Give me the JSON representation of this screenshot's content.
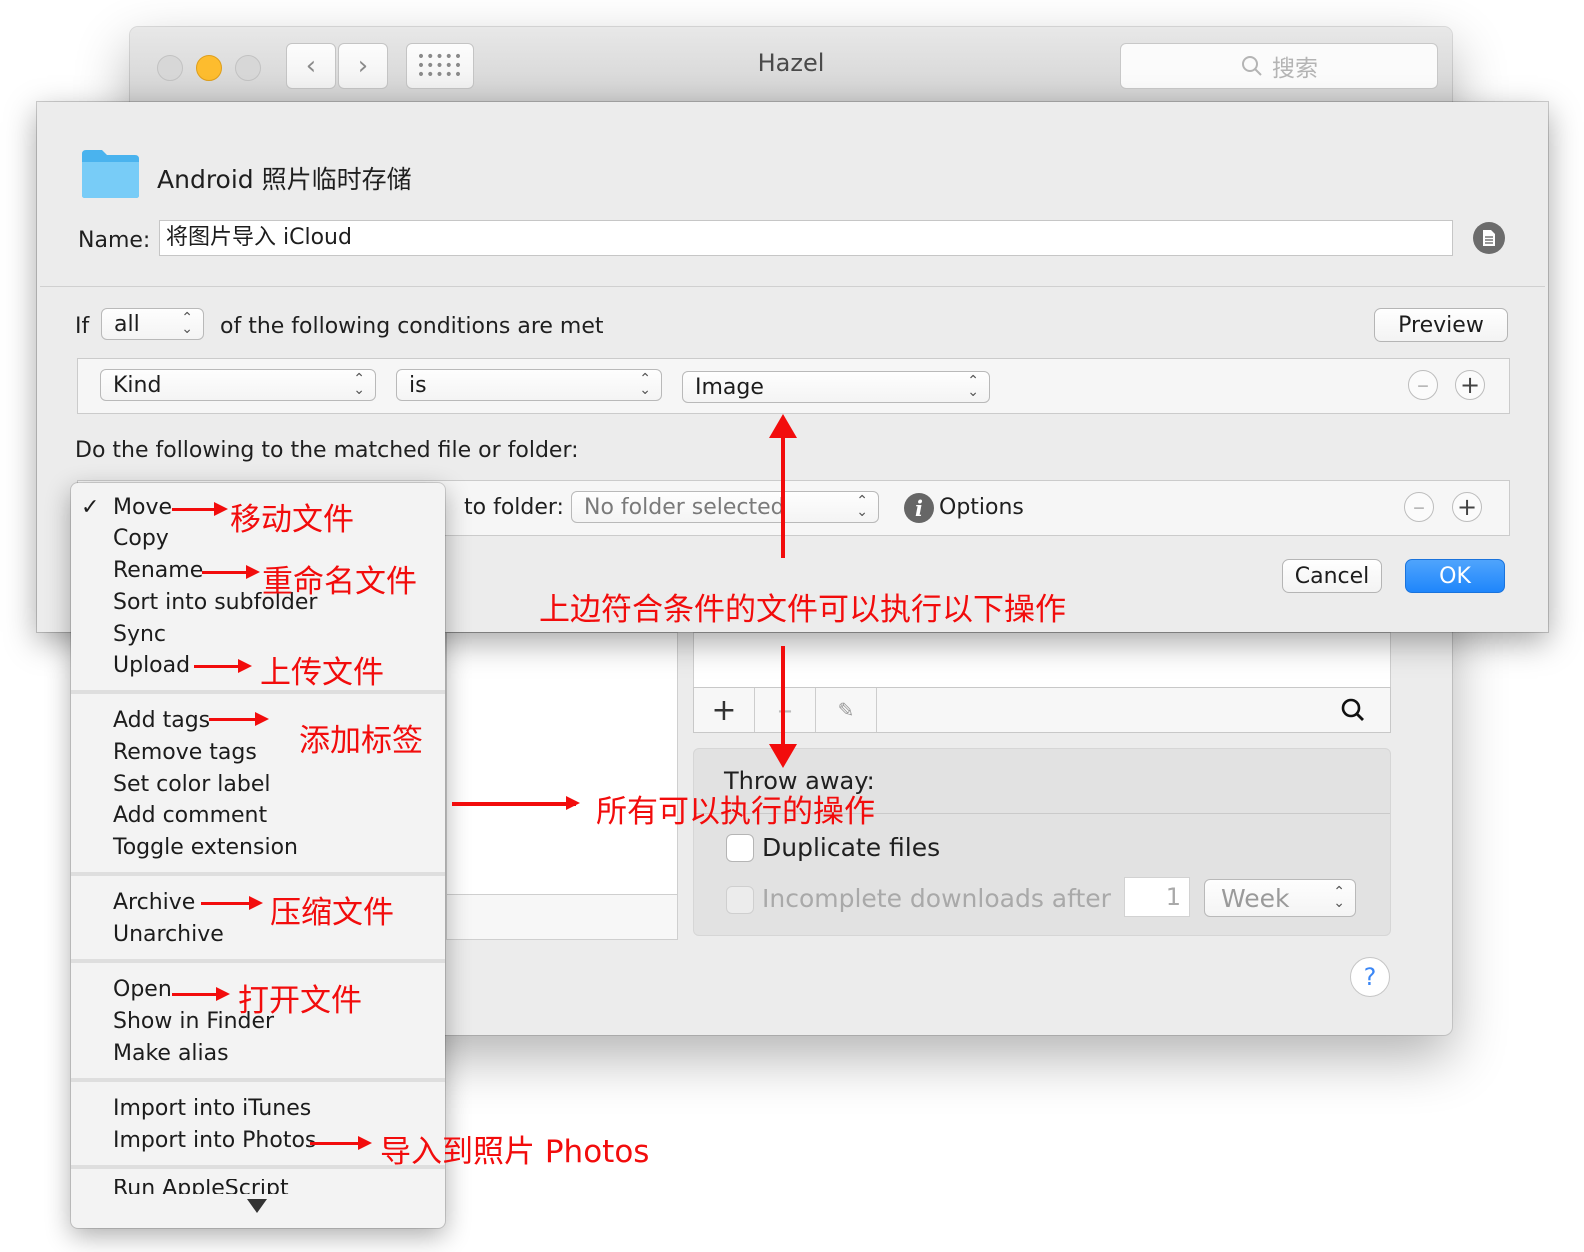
{
  "window": {
    "title": "Hazel",
    "search_placeholder": "搜索"
  },
  "sheet": {
    "folder_name": "Android 照片临时存储",
    "name_label": "Name:",
    "name_value": "将图片导入 iCloud",
    "if_label": "If",
    "match_mode": "all",
    "conditions_text": "of the following conditions are met",
    "preview_label": "Preview",
    "condition": {
      "attribute": "Kind",
      "operator": "is",
      "value": "Image"
    },
    "actions_heading": "Do the following to the matched file or folder:",
    "to_folder_label": "to folder:",
    "folder_select": "No folder selected",
    "options_label": "Options",
    "cancel_label": "Cancel",
    "ok_label": "OK"
  },
  "background_panel": {
    "throw_away_label": "Throw away:",
    "duplicate_files_label": "Duplicate files",
    "incomplete_downloads_label": "Incomplete downloads after",
    "incomplete_count": "1",
    "incomplete_unit": "Week",
    "help_label": "?"
  },
  "menu": {
    "checkmark": "✓",
    "group1": [
      "Move",
      "Copy",
      "Rename",
      "Sort into subfolder",
      "Sync",
      "Upload"
    ],
    "group2": [
      "Add tags",
      "Remove tags",
      "Set color label",
      "Add comment",
      "Toggle extension"
    ],
    "group3": [
      "Archive",
      "Unarchive"
    ],
    "group4": [
      "Open",
      "Show in Finder",
      "Make alias"
    ],
    "group5": [
      "Import into iTunes",
      "Import into Photos"
    ],
    "partial_item": "Run AppleScript"
  },
  "annotations": {
    "move": "移动文件",
    "rename": "重命名文件",
    "upload": "上传文件",
    "tags": "添加标签",
    "all_actions": "所有可以执行的操作",
    "archive": "压缩文件",
    "open": "打开文件",
    "photos": "导入到照片 Photos",
    "execute": "上边符合条件的文件可以执行以下操作"
  },
  "colors": {
    "annotation_red": "#f20c0c",
    "ok_blue": "#1f86fb",
    "folder_blue": "#62c3f5"
  }
}
